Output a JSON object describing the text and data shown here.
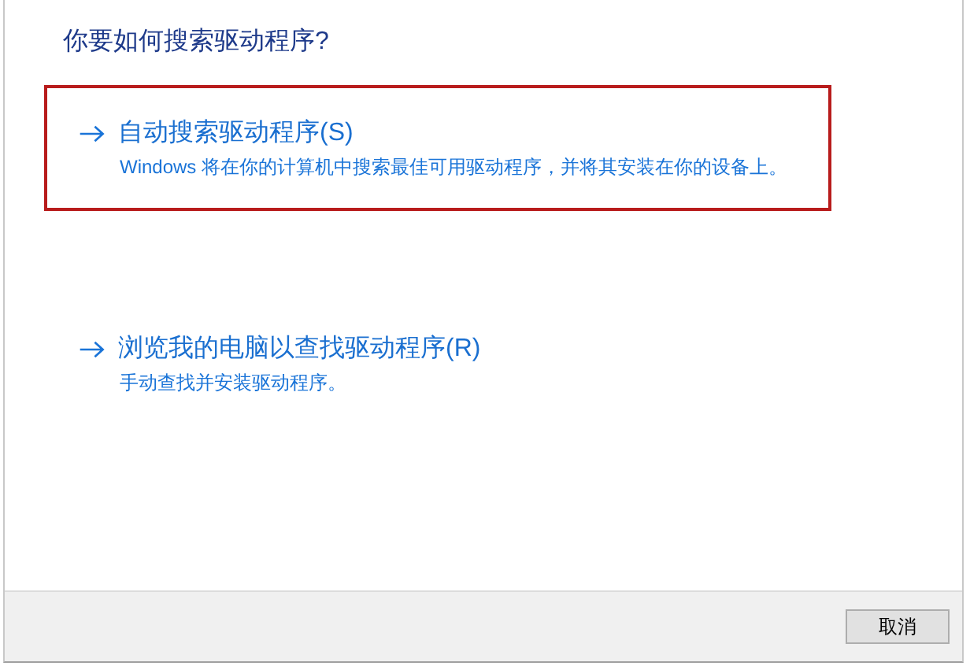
{
  "heading": "你要如何搜索驱动程序?",
  "options": [
    {
      "title": "自动搜索驱动程序(S)",
      "description": "Windows 将在你的计算机中搜索最佳可用驱动程序，并将其安装在你的设备上。",
      "highlighted": true
    },
    {
      "title": "浏览我的电脑以查找驱动程序(R)",
      "description": "手动查找并安装驱动程序。",
      "highlighted": false
    }
  ],
  "buttons": [
    "取消"
  ]
}
